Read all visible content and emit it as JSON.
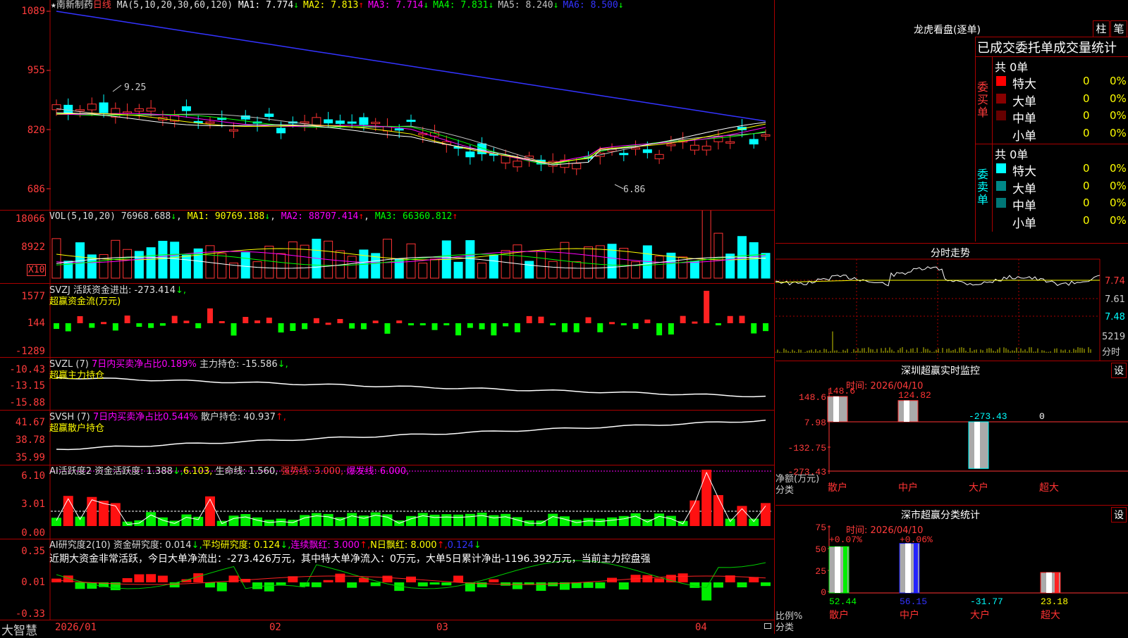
{
  "stock": {
    "star": "★",
    "name": "南新制药",
    "period": "日线",
    "ma_head": "MA(5,10,20,30,60,120)",
    "ma": [
      {
        "label": "MA1:",
        "val": "7.774",
        "arrow": "↓",
        "color": "#ffffff"
      },
      {
        "label": "MA2:",
        "val": "7.813",
        "arrow": "↑",
        "color": "#ffff00"
      },
      {
        "label": "MA3:",
        "val": "7.714",
        "arrow": "↓",
        "color": "#ff00ff"
      },
      {
        "label": "MA4:",
        "val": "7.831",
        "arrow": "↓",
        "color": "#00ff00"
      },
      {
        "label": "MA5:",
        "val": "8.240",
        "arrow": "↓",
        "color": "#c0c0c0"
      },
      {
        "label": "MA6:",
        "val": "8.500",
        "arrow": "↓",
        "color": "#3333ff"
      }
    ],
    "axis": [
      "1089",
      "955",
      "820",
      "686"
    ],
    "hi_label": "9.25",
    "lo_label": "6.86"
  },
  "vol": {
    "head": "VOL(5,10,20)",
    "val": "76968.688",
    "a0": "↓",
    "ma1": "MA1: 90769.188",
    "a1": "↓",
    "ma2": "MA2: 88707.414",
    "a2": "↑",
    "ma3": "MA3: 66360.812",
    "a3": "↑",
    "axis": [
      "18066",
      "8922"
    ],
    "unit": "X10"
  },
  "svzj": {
    "head": "SVZJ  活跃资金进出: -273.414",
    "arrow": "↓,",
    "sub": "超赢资金流(万元)",
    "axis": [
      "1577",
      "144",
      "-1289"
    ]
  },
  "svzl": {
    "head": "SVZL (7)",
    "p1": "7日内买卖净占比0.189%",
    "p2": "主力持仓: -15.586",
    "arrow": "↓,",
    "sub": "超赢主力持仓",
    "axis": [
      "-10.43",
      "-13.15",
      "-15.88"
    ]
  },
  "svsh": {
    "head": "SVSH (7)",
    "p1": "7日内买卖净占比0.544%",
    "p2": "散户持仓: 40.937",
    "arrow": "↑,",
    "sub": "超赢散户持仓",
    "axis": [
      "41.67",
      "38.78",
      "35.99"
    ]
  },
  "ai1": {
    "head": "AI活跃度2 资金活跃度: 1.388",
    "a": "↓,",
    "v2": "6.103,",
    "life": "生命线: 1.560,",
    "strong": "强势线: 3.000,",
    "burst": "爆发线: 6.000,",
    "axis": [
      "6.10",
      "3.01",
      "0.00"
    ]
  },
  "ai2": {
    "head": "AI研究度2(10) 资金研究度: 0.014",
    "a": "↓,",
    "avg": "平均研究度: 0.124",
    "a2": "↓,",
    "lian": "连续飘红: 3.000",
    "a3": "↑,",
    "nred": "N日飘红: 8.000",
    "a4": "↑,",
    "v5": "0.124",
    "a5": "↓",
    "note": "近期大资金非常活跃，今日大单净流出：-273.426万元，其中特大单净流入：0万元，大单5日累计净出-1196.392万元，当前主力控盘强",
    "axis": [
      "0.35",
      "0.01",
      "-0.33"
    ]
  },
  "bottom": {
    "brand": "大智慧",
    "dates": [
      "2026/01",
      "02",
      "03",
      "04"
    ]
  },
  "right": {
    "title": "龙虎看盘(逐单)",
    "btn1": "柱",
    "btn2": "笔",
    "sub": "已成交委托单成交量统计",
    "buy_label": "委买单",
    "buy_total": "共 0单",
    "sell_label": "委卖单",
    "sell_total": "共 0单",
    "rows_buy": [
      {
        "name": "特大",
        "n": "0",
        "p": "0%",
        "c": "#ff0000"
      },
      {
        "name": "大单",
        "n": "0",
        "p": "0%",
        "c": "#880000"
      },
      {
        "name": "中单",
        "n": "0",
        "p": "0%",
        "c": "#660000"
      },
      {
        "name": "小单",
        "n": "0",
        "p": "0%",
        "c": "#000000"
      }
    ],
    "rows_sell": [
      {
        "name": "特大",
        "n": "0",
        "p": "0%",
        "c": "#00ffff"
      },
      {
        "name": "大单",
        "n": "0",
        "p": "0%",
        "c": "#008888"
      },
      {
        "name": "中单",
        "n": "0",
        "p": "0%",
        "c": "#007777"
      },
      {
        "name": "小单",
        "n": "0",
        "p": "0%",
        "c": "#000000"
      }
    ],
    "fenshi_title": "分时走势",
    "fenshi_axis": [
      "7.74",
      "7.61",
      "7.48"
    ],
    "fenshi_vol": "5219",
    "fenshi_unit": "分时",
    "mon_title": "深圳超赢实时监控",
    "mon_set": "设",
    "mon_time": "时间: 2026/04/10",
    "mon_axis": [
      "148.6",
      "7.98",
      "-132.75",
      "-273.43"
    ],
    "mon_ylab1": "净额(万元)",
    "mon_ylab2": "分类",
    "mon_vals": [
      "148.6",
      "124.82",
      "-273.43",
      "0"
    ],
    "mon_cats": [
      "散户",
      "中户",
      "大户",
      "超大"
    ],
    "cls_title": "深市超赢分类统计",
    "cls_set": "设",
    "cls_time": "时间: 2026/04/10",
    "cls_axis": [
      "75",
      "50",
      "25",
      "0"
    ],
    "cls_tops": [
      "+0.07%",
      "+0.06%"
    ],
    "cls_vals": [
      "52.44",
      "56.15",
      "-31.77",
      "23.18"
    ],
    "cls_ylab1": "比例%",
    "cls_ylab2": "分类",
    "cls_cats": [
      "散户",
      "中户",
      "大户",
      "超大"
    ]
  }
}
